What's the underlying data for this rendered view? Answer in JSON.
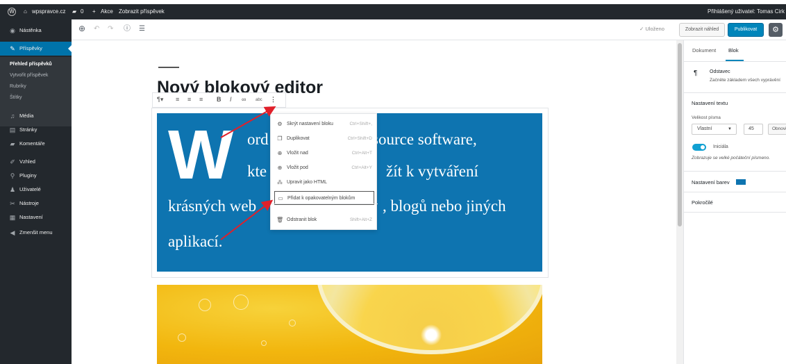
{
  "adminbar": {
    "site_name": "wpspravce.cz",
    "comments_count": "0",
    "new_label": "Akce",
    "view_post": "Zobrazit příspěvek",
    "user_text": "Přihlášený uživatel: Tomas Cirk"
  },
  "sidebar": {
    "items": [
      {
        "label": "Nástěnka",
        "icon": "dashboard-icon"
      },
      {
        "label": "Příspěvky",
        "icon": "pin-icon"
      },
      {
        "label": "Média",
        "icon": "media-icon"
      },
      {
        "label": "Stránky",
        "icon": "pages-icon"
      },
      {
        "label": "Komentáře",
        "icon": "comments-icon"
      },
      {
        "label": "Vzhled",
        "icon": "appearance-icon"
      },
      {
        "label": "Pluginy",
        "icon": "plugins-icon"
      },
      {
        "label": "Uživatelé",
        "icon": "users-icon"
      },
      {
        "label": "Nástroje",
        "icon": "tools-icon"
      },
      {
        "label": "Nastavení",
        "icon": "settings-icon"
      },
      {
        "label": "Zmenšit menu",
        "icon": "collapse-icon"
      }
    ],
    "submenu": [
      "Přehled příspěvků",
      "Vytvořit příspěvek",
      "Rubriky",
      "Štítky"
    ]
  },
  "header": {
    "saved": "✓ Uloženo",
    "preview": "Zobrazit náhled",
    "publish": "Publikovat"
  },
  "post": {
    "title": "Nový blokový editor",
    "dropcap": "W",
    "line1": "ord",
    "line1b": "source software,",
    "line2": "kte",
    "line2b": "žít k vytváření",
    "line3a": "krásných web",
    "line3b": ", blogů nebo jiných",
    "line4": "aplikací."
  },
  "dropdown": {
    "items": [
      {
        "label": "Skrýt nastavení bloku",
        "shortcut": "Ctrl+Shift+,",
        "icon": "gear-icon"
      },
      {
        "label": "Duplikovat",
        "shortcut": "Ctrl+Shift+D",
        "icon": "duplicate-icon"
      },
      {
        "label": "Vložit nad",
        "shortcut": "Ctrl+Alt+T",
        "icon": "insert-before-icon"
      },
      {
        "label": "Vložit pod",
        "shortcut": "Ctrl+Alt+Y",
        "icon": "insert-after-icon"
      },
      {
        "label": "Upravit jako HTML",
        "shortcut": "",
        "icon": "html-icon"
      },
      {
        "label": "Přidat k opakovatelným blokům",
        "shortcut": "",
        "icon": "reusable-icon"
      },
      {
        "label": "Odstranit blok",
        "shortcut": "Shift+Alt+Z",
        "icon": "trash-icon"
      }
    ]
  },
  "panel": {
    "tab_document": "Dokument",
    "tab_block": "Blok",
    "block_name": "Odstavec",
    "block_desc": "Začněte základem všech vyprávění",
    "text_settings": "Nastavení textu",
    "font_size_label": "Velikost písma",
    "font_size_select": "Vlastní",
    "font_size_value": "45",
    "reset": "Obnovit",
    "dropcap_label": "Iniciála",
    "dropcap_help": "Zobrazuje se velké počáteční písmeno.",
    "color_settings": "Nastavení barev",
    "advanced": "Pokročilé"
  },
  "colors": {
    "admin_bg": "#23282d",
    "accent": "#0073aa",
    "block_bg": "#0e74b0",
    "arrow": "#e0202a"
  }
}
